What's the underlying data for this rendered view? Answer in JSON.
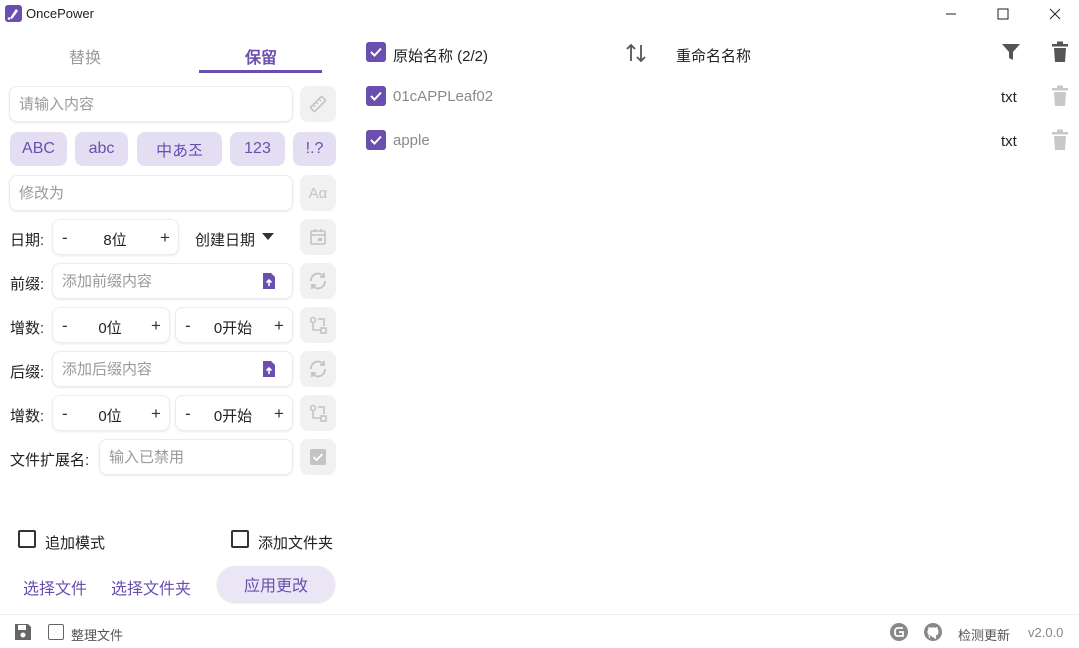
{
  "window": {
    "title": "OncePower"
  },
  "tabs": [
    {
      "label": "替换",
      "active": false
    },
    {
      "label": "保留",
      "active": true
    }
  ],
  "left": {
    "search_placeholder": "请输入内容",
    "chips": [
      "ABC",
      "abc",
      "中あ조",
      "123",
      "!.?"
    ],
    "modify_placeholder": "修改为",
    "date": {
      "label": "日期:",
      "digits": "8位",
      "type": "创建日期"
    },
    "prefix": {
      "label": "前缀:",
      "placeholder": "添加前缀内容"
    },
    "prefix_increment": {
      "label": "增数:",
      "digits": "0位",
      "start": "0开始"
    },
    "suffix": {
      "label": "后缀:",
      "placeholder": "添加后缀内容"
    },
    "suffix_increment": {
      "label": "增数:",
      "digits": "0位",
      "start": "0开始"
    },
    "extension": {
      "label": "文件扩展名:",
      "placeholder": "输入已禁用"
    },
    "append_mode": "追加模式",
    "add_folder": "添加文件夹",
    "select_files": "选择文件",
    "select_folder": "选择文件夹",
    "apply": "应用更改"
  },
  "list": {
    "header_original": "原始名称 (2/2)",
    "header_renamed": "重命名名称",
    "files": [
      {
        "name": "01cAPPLeaf02",
        "ext": "txt",
        "checked": true
      },
      {
        "name": "apple",
        "ext": "txt",
        "checked": true
      }
    ]
  },
  "status": {
    "organize_files": "整理文件",
    "check_update": "检测更新",
    "version": "v2.0.0"
  },
  "colors": {
    "accent": "#6a4fb0",
    "chip_bg": "#e4def3"
  }
}
